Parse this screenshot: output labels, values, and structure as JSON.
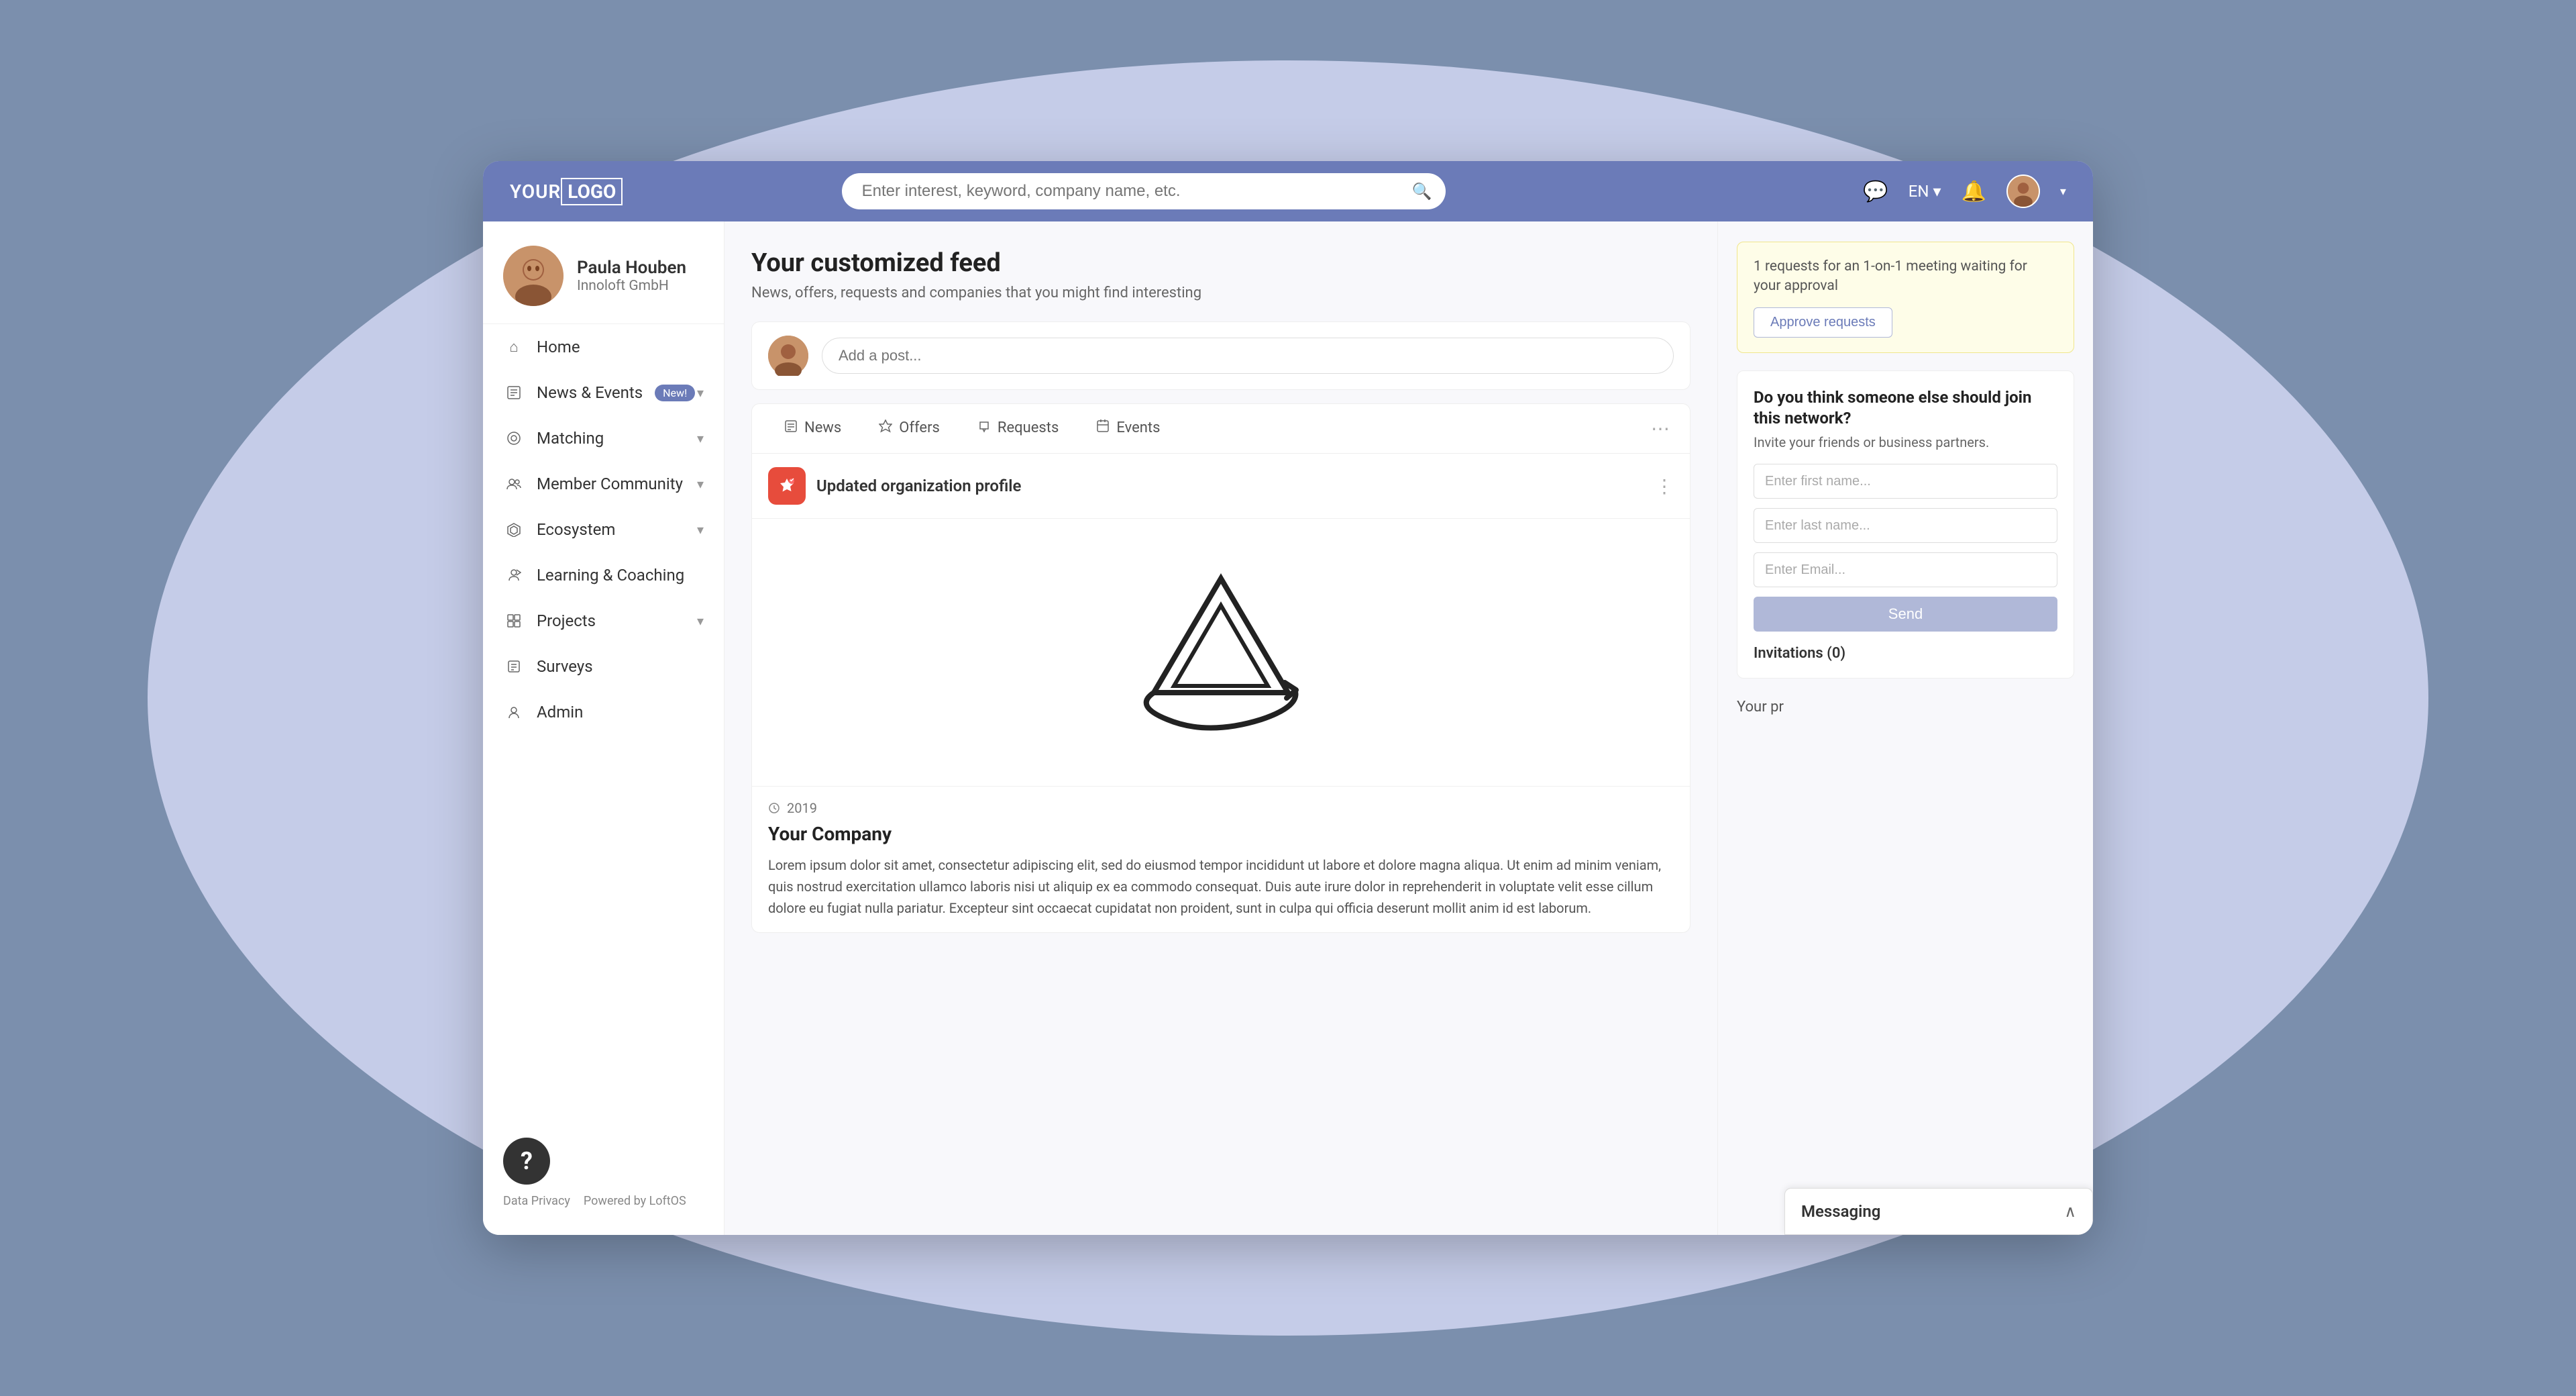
{
  "app": {
    "title": "YOUR LOGO"
  },
  "topbar": {
    "logo_text": "YOUR ",
    "logo_box": "LOGO",
    "search_placeholder": "Enter interest, keyword, company name, etc.",
    "lang": "EN",
    "chat_icon": "💬",
    "bell_icon": "🔔"
  },
  "sidebar": {
    "user": {
      "name": "Paula Houben",
      "company": "Innoloft GmbH"
    },
    "nav_items": [
      {
        "id": "home",
        "label": "Home",
        "icon": "⌂",
        "has_chevron": false,
        "badge": ""
      },
      {
        "id": "news-events",
        "label": "News & Events",
        "icon": "📰",
        "has_chevron": true,
        "badge": "New!"
      },
      {
        "id": "matching",
        "label": "Matching",
        "icon": "◎",
        "has_chevron": true,
        "badge": ""
      },
      {
        "id": "member-community",
        "label": "Member Community",
        "icon": "👥",
        "has_chevron": true,
        "badge": ""
      },
      {
        "id": "ecosystem",
        "label": "Ecosystem",
        "icon": "✦",
        "has_chevron": true,
        "badge": ""
      },
      {
        "id": "learning-coaching",
        "label": "Learning & Coaching",
        "icon": "🎓",
        "has_chevron": false,
        "badge": ""
      },
      {
        "id": "projects",
        "label": "Projects",
        "icon": "▦",
        "has_chevron": true,
        "badge": ""
      },
      {
        "id": "surveys",
        "label": "Surveys",
        "icon": "☰",
        "has_chevron": false,
        "badge": ""
      },
      {
        "id": "admin",
        "label": "Admin",
        "icon": "👤",
        "has_chevron": false,
        "badge": ""
      }
    ],
    "footer": {
      "data_privacy": "Data Privacy",
      "powered_by": "Powered by LoftOS"
    }
  },
  "feed": {
    "title": "Your customized feed",
    "subtitle": "News, offers, requests and companies that you might find interesting",
    "composer_placeholder": "Add a post...",
    "tabs": [
      {
        "id": "news",
        "label": "News",
        "icon": "☰"
      },
      {
        "id": "offers",
        "label": "Offers",
        "icon": "⬡"
      },
      {
        "id": "requests",
        "label": "Requests",
        "icon": "📢"
      },
      {
        "id": "events",
        "label": "Events",
        "icon": "🖼"
      }
    ],
    "post": {
      "action": "Updated organization profile",
      "year": "2019",
      "company_name": "Your Company",
      "description": "Lorem ipsum dolor sit amet, consectetur adipiscing elit, sed do eiusmod tempor incididunt ut labore et dolore magna aliqua. Ut enim ad minim veniam, quis nostrud exercitation ullamco laboris nisi ut aliquip ex ea commodo consequat. Duis aute irure dolor in reprehenderit in voluptate velit esse cillum dolore eu fugiat nulla pariatur. Excepteur sint occaecat cupidatat non proident, sunt in culpa qui officia deserunt mollit anim id est laborum."
    }
  },
  "right_panel": {
    "notification": {
      "text": "1 requests for an 1-on-1 meeting waiting for your approval",
      "approve_label": "Approve requests"
    },
    "invite": {
      "title": "Do you think someone else should join this network?",
      "subtitle": "Invite your friends or business partners.",
      "first_name_placeholder": "Enter first name...",
      "last_name_placeholder": "Enter last name...",
      "email_placeholder": "Enter Email...",
      "send_label": "Send",
      "invitations_label": "Invitations (0)"
    },
    "your_profile_label": "Your pr"
  },
  "messaging": {
    "label": "Messaging"
  }
}
